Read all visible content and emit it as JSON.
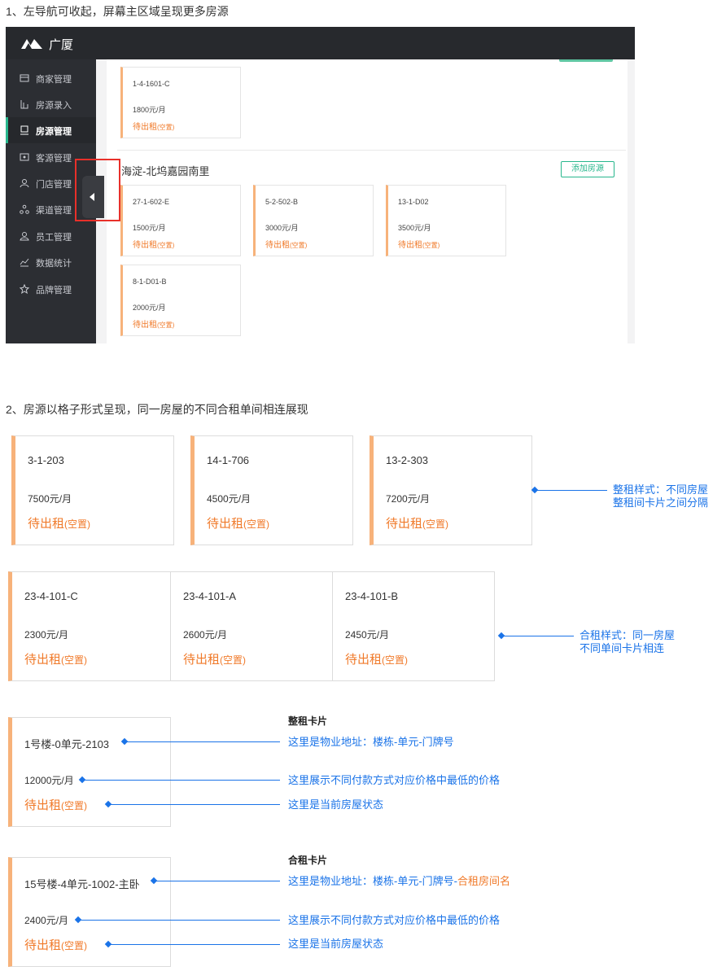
{
  "section1": {
    "heading": "1、左导航可收起，屏幕主区域呈现更多房源",
    "app": {
      "brand": "广厦",
      "nav": [
        {
          "label": "商家管理",
          "icon": "store-icon",
          "active": false
        },
        {
          "label": "房源录入",
          "icon": "house-entry-icon",
          "active": false
        },
        {
          "label": "房源管理",
          "icon": "house-manage-icon",
          "active": true
        },
        {
          "label": "客源管理",
          "icon": "client-icon",
          "active": false
        },
        {
          "label": "门店管理",
          "icon": "shop-icon",
          "active": false
        },
        {
          "label": "渠道管理",
          "icon": "channel-icon",
          "active": false
        },
        {
          "label": "员工管理",
          "icon": "staff-icon",
          "active": false
        },
        {
          "label": "数据统计",
          "icon": "chart-icon",
          "active": false
        },
        {
          "label": "品牌管理",
          "icon": "star-icon",
          "active": false
        }
      ],
      "top_card": {
        "code": "1-4-1601-C",
        "price": "1800元/月",
        "status": "待出租",
        "sub": "(空置)"
      },
      "group": {
        "title": "海淀-北坞嘉园南里",
        "add_button": "添加房源",
        "cards": [
          {
            "code": "27-1-602-E",
            "price": "1500元/月",
            "status": "待出租",
            "sub": "(空置)"
          },
          {
            "code": "5-2-502-B",
            "price": "3000元/月",
            "status": "待出租",
            "sub": "(空置)"
          },
          {
            "code": "13-1-D02",
            "price": "3500元/月",
            "status": "待出租",
            "sub": "(空置)"
          },
          {
            "code": "8-1-D01-B",
            "price": "2000元/月",
            "status": "待出租",
            "sub": "(空置)"
          }
        ]
      }
    }
  },
  "section2": {
    "heading": "2、房源以格子形式呈现，同一房屋的不同合租单间相连展现",
    "whole": [
      {
        "code": "3-1-203",
        "price": "7500元/月",
        "status": "待出租",
        "sub": "(空置)"
      },
      {
        "code": "14-1-706",
        "price": "4500元/月",
        "status": "待出租",
        "sub": "(空置)"
      },
      {
        "code": "13-2-303",
        "price": "7200元/月",
        "status": "待出租",
        "sub": "(空置)"
      }
    ],
    "whole_note": [
      "整租样式：不同房屋",
      "整租间卡片之间分隔"
    ],
    "shared": [
      {
        "code": "23-4-101-C",
        "price": "2300元/月",
        "status": "待出租",
        "sub": "(空置)"
      },
      {
        "code": "23-4-101-A",
        "price": "2600元/月",
        "status": "待出租",
        "sub": "(空置)"
      },
      {
        "code": "23-4-101-B",
        "price": "2450元/月",
        "status": "待出租",
        "sub": "(空置)"
      }
    ],
    "shared_note": [
      "合租样式：同一房屋",
      "不同单间卡片相连"
    ]
  },
  "legend_whole": {
    "title": "整租卡片",
    "card": {
      "code": "1号楼-0单元-2103",
      "price": "12000元/月",
      "status": "待出租",
      "sub": "(空置)"
    },
    "notes": [
      "这里是物业地址：楼栋-单元-门牌号",
      "这里展示不同付款方式对应价格中最低的价格",
      "这里是当前房屋状态"
    ]
  },
  "legend_shared": {
    "title": "合租卡片",
    "card": {
      "code": "15号楼-4单元-1002-主卧",
      "price": "2400元/月",
      "status": "待出租",
      "sub": "(空置)"
    },
    "notes_address": "这里是物业地址：楼栋-单元-门牌号-",
    "notes_address_highlight": "合租房间名",
    "notes": [
      "这里展示不同付款方式对应价格中最低的价格",
      "这里是当前房屋状态"
    ]
  },
  "colors": {
    "accent_green": "#28b78d",
    "card_border_orange": "#f7b27a",
    "status_orange": "#f07a2a",
    "annotation_blue": "#1a73e8",
    "sidebar_dark": "#2c2e33"
  }
}
